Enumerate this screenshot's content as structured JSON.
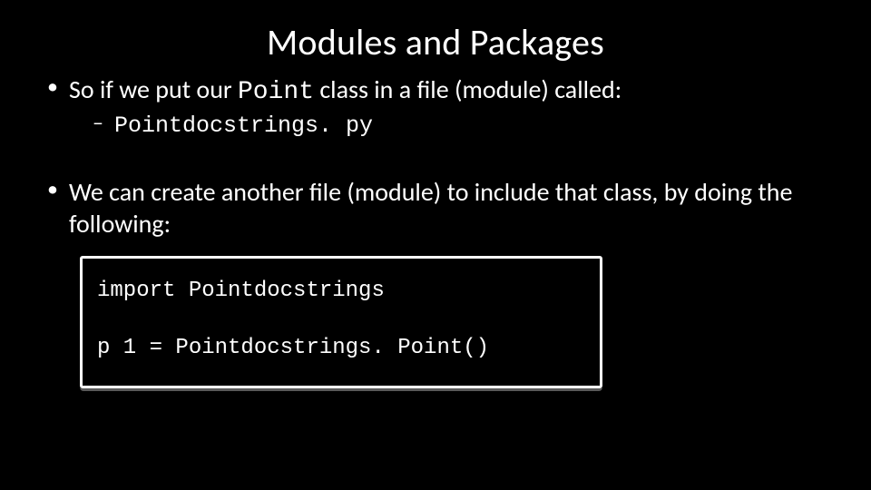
{
  "title": "Modules and Packages",
  "bullet1": {
    "pre": "So if we put our ",
    "classname": "Point",
    "post": " class in a file (module) called:",
    "sub": "Pointdocstrings. py"
  },
  "bullet2": "We can create another file (module) to include that class, by doing the following:",
  "code": {
    "line1": "import Pointdocstrings",
    "blank": " ",
    "line2": "p 1 = Pointdocstrings. Point()"
  }
}
